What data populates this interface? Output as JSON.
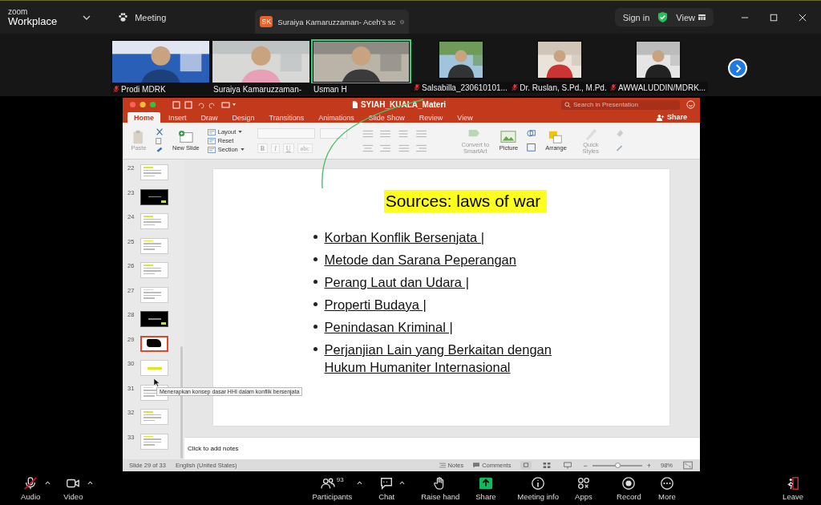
{
  "title_bar": {
    "brand_top": "zoom",
    "brand": "Workplace",
    "meeting_tab": "Meeting",
    "share_tab": {
      "initials": "SK",
      "title": "Suraiya Kamaruzzaman- Aceh's sc"
    },
    "sign_in": "Sign in",
    "view": "View"
  },
  "participants": [
    {
      "name": "Prodi MDRK",
      "kind": "large",
      "muted": true,
      "active": false
    },
    {
      "name": "Suraiya Kamaruzzaman-",
      "kind": "large",
      "muted": false,
      "active": false
    },
    {
      "name": "Usman H",
      "kind": "large",
      "muted": false,
      "active": true
    },
    {
      "name": "Salsabilla_230610101...",
      "kind": "small",
      "muted": true,
      "active": false
    },
    {
      "name": "Dr. Ruslan, S.Pd., M.Pd.",
      "kind": "small",
      "muted": true,
      "active": false
    },
    {
      "name": "AWWALUDDIN/MDRK...",
      "kind": "small",
      "muted": true,
      "active": false
    }
  ],
  "presentation": {
    "file_name": "SYIAH_KUALA_Materi",
    "search": {
      "placeholder": "Search in Presentation"
    },
    "share": "Share",
    "tabs": [
      {
        "label": "Home",
        "selected": true
      },
      {
        "label": "Insert",
        "selected": false
      },
      {
        "label": "Draw",
        "selected": false
      },
      {
        "label": "Design",
        "selected": false
      },
      {
        "label": "Transitions",
        "selected": false
      },
      {
        "label": "Animations",
        "selected": false
      },
      {
        "label": "Slide Show",
        "selected": false
      },
      {
        "label": "Review",
        "selected": false
      },
      {
        "label": "View",
        "selected": false
      }
    ],
    "ribbon": {
      "paste": {
        "label": "Paste",
        "disabled": true
      },
      "new_slide": "New Slide",
      "slide_commands": [
        {
          "label": "Layout",
          "menu": true
        },
        {
          "label": "Reset",
          "menu": false
        },
        {
          "label": "Section",
          "menu": true
        }
      ],
      "format_buttons": [
        {
          "label": "B",
          "disabled": true
        },
        {
          "label": "I",
          "disabled": true
        },
        {
          "label": "U",
          "disabled": true
        },
        {
          "label": "abc",
          "disabled": true
        }
      ],
      "smartart": {
        "label": "Convert to SmartArt",
        "disabled": true
      },
      "picture": "Picture",
      "arrange": "Arrange",
      "quick_styles": {
        "label": "Quick Styles",
        "disabled": true
      }
    },
    "slides": [
      {
        "number": "22",
        "kind": "text",
        "selected": false
      },
      {
        "number": "23",
        "kind": "dark",
        "selected": false
      },
      {
        "number": "24",
        "kind": "text",
        "selected": false
      },
      {
        "number": "25",
        "kind": "text",
        "selected": false
      },
      {
        "number": "26",
        "kind": "text",
        "selected": false
      },
      {
        "number": "27",
        "kind": "text",
        "selected": false
      },
      {
        "number": "28",
        "kind": "dark",
        "selected": false
      },
      {
        "number": "29",
        "kind": "blot",
        "selected": true
      },
      {
        "number": "30",
        "kind": "title",
        "selected": false
      },
      {
        "number": "31",
        "kind": "text",
        "selected": false
      },
      {
        "number": "32",
        "kind": "text",
        "selected": false
      },
      {
        "number": "33",
        "kind": "text",
        "selected": false
      }
    ],
    "tooltip": "Menerapkan konsep dasar HHI dalam konflik bersenjata",
    "slide": {
      "title": "Sources: laws of war",
      "bullets": [
        "Korban Konflik Bersenjata |",
        "Metode dan Sarana Peperangan",
        "Perang Laut dan Udara |",
        "Properti Budaya |",
        "Penindasan Kriminal |",
        "Perjanjian Lain yang Berkaitan dengan Hukum Humaniter Internasional"
      ]
    },
    "notes": {
      "placeholder": "Click to add notes"
    },
    "status_bar": {
      "slide_count": "Slide 29 of 33",
      "language": "English (United States)",
      "notes": "Notes",
      "comments": "Comments",
      "zoom_out": "−",
      "zoom": {
        "level": 0.5
      },
      "zoom_in": "+",
      "zoom_reading": "98%"
    }
  },
  "toolbar": [
    {
      "label": "Audio",
      "kind": "audio",
      "muted": true,
      "menu": true
    },
    {
      "label": "Video",
      "kind": "video",
      "muted": false,
      "menu": true
    },
    {
      "label": "Participants",
      "kind": "participants",
      "count": "93",
      "menu": true
    },
    {
      "label": "Chat",
      "kind": "chat",
      "menu": true
    },
    {
      "label": "Raise hand",
      "kind": "hand",
      "menu": false
    },
    {
      "label": "Share",
      "kind": "share",
      "menu": false
    },
    {
      "label": "Meeting info",
      "kind": "info",
      "menu": false
    },
    {
      "label": "Apps",
      "kind": "apps",
      "menu": false
    },
    {
      "label": "Record",
      "kind": "record",
      "menu": false
    },
    {
      "label": "More",
      "kind": "more",
      "menu": false
    },
    {
      "label": "Leave",
      "kind": "leave",
      "menu": false
    }
  ]
}
